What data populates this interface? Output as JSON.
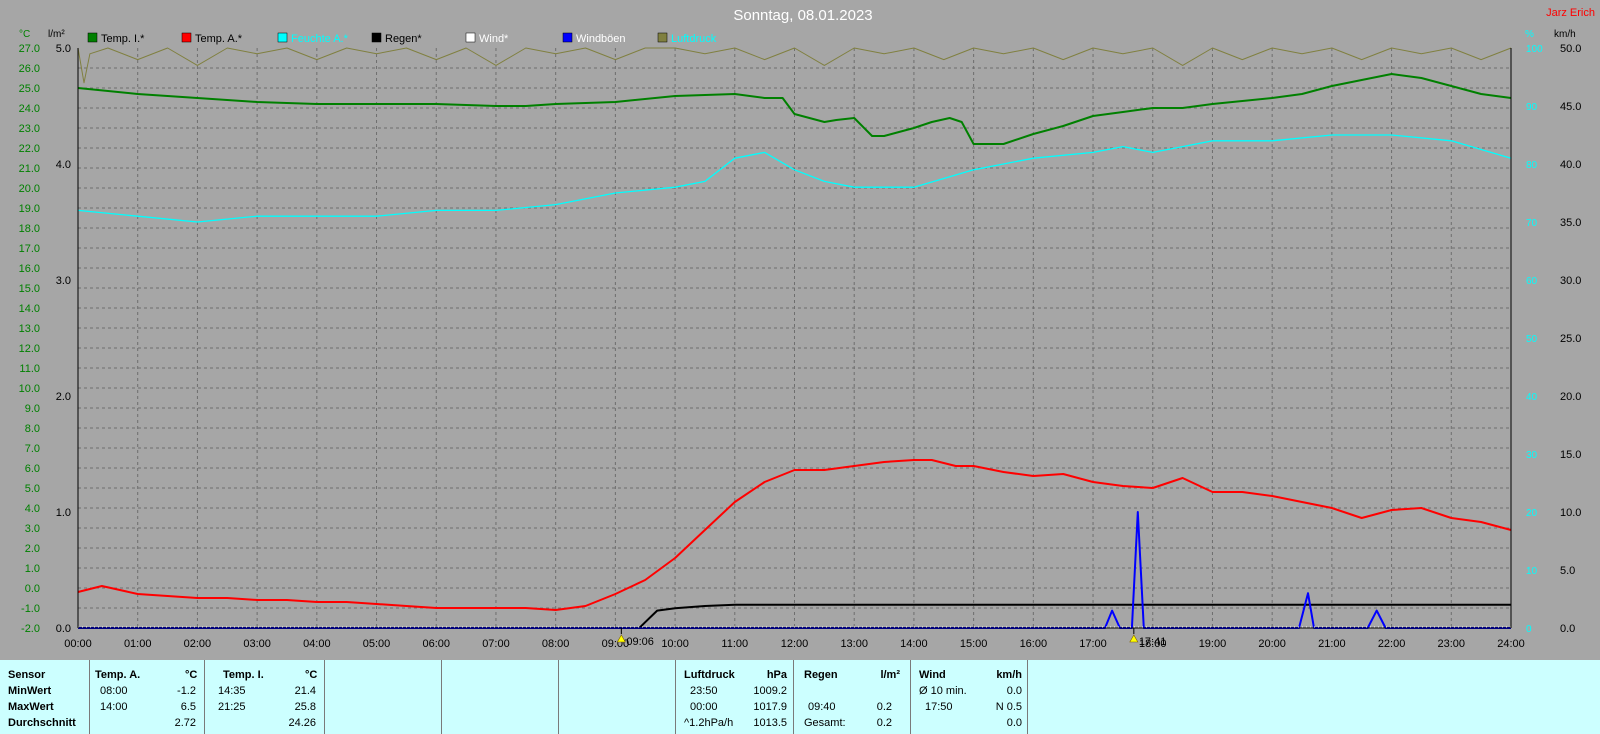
{
  "title": "Sonntag, 08.01.2023",
  "author": "Jarz Erich",
  "axis_units": {
    "temp": "°C",
    "rain": "l/m²",
    "humidity": "%",
    "wind": "km/h"
  },
  "colors": {
    "temp_in": "#008000",
    "temp_out": "#ff0000",
    "humidity": "#00ffff",
    "rain": "#000000",
    "wind": "#ffffff",
    "gusts": "#0000ff",
    "pressure": "#808040"
  },
  "legend": [
    {
      "label": "Temp. I.*",
      "color": "#008000",
      "text_color": "#000000"
    },
    {
      "label": "Temp. A.*",
      "color": "#ff0000",
      "text_color": "#000000"
    },
    {
      "label": "Feuchte A.*",
      "color": "#00ffff",
      "text_color": "#00ffff"
    },
    {
      "label": "Regen*",
      "color": "#000000",
      "text_color": "#000000"
    },
    {
      "label": "Wind*",
      "color": "#ffffff",
      "text_color": "#ffffff"
    },
    {
      "label": "Windböen",
      "color": "#0000ff",
      "text_color": "#ffffff"
    },
    {
      "label": "Luftdruck",
      "color": "#808040",
      "text_color": "#00ffff"
    }
  ],
  "markers": [
    {
      "icon": "sunrise-icon",
      "label": "09:06",
      "hour": 9.1
    },
    {
      "icon": "sunset-icon",
      "label": "17:41",
      "hour": 17.683
    }
  ],
  "chart_data": {
    "type": "line",
    "x_range": [
      0,
      24
    ],
    "x_tick_labels": [
      "00:00",
      "01:00",
      "02:00",
      "03:00",
      "04:00",
      "05:00",
      "06:00",
      "07:00",
      "08:00",
      "09:00",
      "10:00",
      "11:00",
      "12:00",
      "13:00",
      "14:00",
      "15:00",
      "16:00",
      "17:00",
      "18:00",
      "19:00",
      "20:00",
      "21:00",
      "22:00",
      "23:00",
      "24:00"
    ],
    "temp_axis": {
      "range": [
        -2,
        27
      ],
      "tick_labels": [
        "27.0",
        "26.0",
        "25.0",
        "24.0",
        "23.0",
        "22.0",
        "21.0",
        "20.0",
        "19.0",
        "18.0",
        "17.0",
        "16.0",
        "15.0",
        "14.0",
        "13.0",
        "12.0",
        "11.0",
        "10.0",
        "9.0",
        "8.0",
        "7.0",
        "6.0",
        "5.0",
        "4.0",
        "3.0",
        "2.0",
        "1.0",
        "0.0",
        "-1.0",
        "-2.0"
      ]
    },
    "rain_axis": {
      "range": [
        0,
        5
      ],
      "tick_labels": [
        "5.0",
        "4.0",
        "3.0",
        "2.0",
        "1.0",
        "0.0"
      ]
    },
    "humidity_axis": {
      "range": [
        0,
        100
      ],
      "tick_labels": [
        "100",
        "90",
        "80",
        "70",
        "60",
        "50",
        "40",
        "30",
        "20",
        "10",
        "0"
      ]
    },
    "wind_axis": {
      "range": [
        0,
        50
      ],
      "tick_labels": [
        "50.0",
        "45.0",
        "40.0",
        "35.0",
        "30.0",
        "25.0",
        "20.0",
        "15.0",
        "10.0",
        "5.0",
        "0.0"
      ]
    },
    "series": [
      {
        "name": "Temp. I.*",
        "axis": "temp",
        "color": "#008000",
        "x": [
          0,
          1,
          2,
          3,
          4,
          5,
          6,
          7,
          7.5,
          8,
          9,
          10,
          11,
          11.5,
          11.8,
          12,
          12.5,
          12.7,
          13,
          13.3,
          13.5,
          14,
          14.3,
          14.6,
          14.8,
          15,
          15.5,
          16,
          16.5,
          17,
          17.5,
          18,
          18.5,
          19,
          20,
          20.5,
          21,
          21.5,
          22,
          22.5,
          23,
          23.5,
          24
        ],
        "y": [
          25.0,
          24.7,
          24.5,
          24.3,
          24.2,
          24.2,
          24.2,
          24.1,
          24.1,
          24.2,
          24.3,
          24.6,
          24.7,
          24.5,
          24.5,
          23.7,
          23.3,
          23.4,
          23.5,
          22.6,
          22.6,
          23.0,
          23.3,
          23.5,
          23.3,
          22.2,
          22.2,
          22.7,
          23.1,
          23.6,
          23.8,
          24.0,
          24.0,
          24.2,
          24.5,
          24.7,
          25.1,
          25.4,
          25.7,
          25.5,
          25.1,
          24.7,
          24.5
        ]
      },
      {
        "name": "Temp. A.*",
        "axis": "temp",
        "color": "#ff0000",
        "x": [
          0,
          0.4,
          1,
          1.5,
          2,
          2.5,
          3,
          3.5,
          4,
          4.5,
          5,
          5.5,
          6,
          6.5,
          7,
          7.5,
          8,
          8.5,
          9,
          9.5,
          10,
          10.5,
          11,
          11.5,
          12,
          12.5,
          13,
          13.5,
          14,
          14.3,
          14.7,
          15,
          15.5,
          16,
          16.5,
          17,
          17.5,
          18,
          18.5,
          19,
          19.5,
          20,
          20.5,
          21,
          21.5,
          22,
          22.5,
          23,
          23.5,
          24
        ],
        "y": [
          -0.2,
          0.1,
          -0.3,
          -0.4,
          -0.5,
          -0.5,
          -0.6,
          -0.6,
          -0.7,
          -0.7,
          -0.8,
          -0.9,
          -1.0,
          -1.0,
          -1.0,
          -1.0,
          -1.1,
          -0.9,
          -0.3,
          0.4,
          1.5,
          2.9,
          4.3,
          5.3,
          5.9,
          5.9,
          6.1,
          6.3,
          6.4,
          6.4,
          6.1,
          6.1,
          5.8,
          5.6,
          5.7,
          5.3,
          5.1,
          5.0,
          5.5,
          4.8,
          4.8,
          4.6,
          4.3,
          4.0,
          3.5,
          3.9,
          4.0,
          3.5,
          3.3,
          2.9
        ]
      },
      {
        "name": "Feuchte A.*",
        "axis": "humidity",
        "color": "#00ffff",
        "x": [
          0,
          1,
          2,
          3,
          4,
          5,
          6,
          7,
          8,
          9,
          10,
          10.5,
          11,
          11.5,
          12,
          12.5,
          13,
          13.5,
          14,
          15,
          16,
          17,
          17.5,
          18,
          18.5,
          19,
          20,
          21,
          22,
          23,
          24
        ],
        "y": [
          72,
          71,
          70,
          71,
          71,
          71,
          72,
          72,
          73,
          75,
          76,
          77,
          81,
          82,
          79,
          77,
          76,
          76,
          76,
          79,
          81,
          82,
          83,
          82,
          83,
          84,
          84,
          85,
          85,
          84,
          81
        ]
      },
      {
        "name": "Regen*",
        "axis": "rain",
        "color": "#000000",
        "x": [
          0,
          9.4,
          9.5,
          9.6,
          9.7,
          10,
          10.5,
          11,
          12,
          24
        ],
        "y": [
          0,
          0,
          0.05,
          0.1,
          0.15,
          0.17,
          0.19,
          0.2,
          0.2,
          0.2
        ]
      },
      {
        "name": "Windböen",
        "axis": "wind",
        "color": "#0000ff",
        "x": [
          0,
          17.2,
          17.32,
          17.45,
          17.65,
          17.75,
          17.85,
          17.95,
          20.3,
          20.45,
          20.6,
          20.7,
          20.8,
          21.6,
          21.75,
          21.9,
          24
        ],
        "y": [
          0,
          0,
          1.5,
          0,
          0,
          10,
          0,
          0,
          0,
          0,
          3,
          0,
          0,
          0,
          1.5,
          0,
          0
        ]
      },
      {
        "name": "Luftdruck",
        "axis": "humidity",
        "color": "#808040",
        "x": [
          0,
          0.1,
          0.2,
          0.5,
          1,
          1.5,
          2,
          2.5,
          3,
          3.5,
          4,
          4.5,
          5,
          5.5,
          6,
          6.5,
          7,
          7.5,
          8,
          8.5,
          9,
          9.5,
          10,
          10.5,
          11,
          11.5,
          12,
          12.5,
          13,
          13.5,
          14,
          14.5,
          15,
          15.5,
          16,
          16.5,
          17,
          17.5,
          18,
          18.5,
          19,
          19.5,
          20,
          20.5,
          21,
          21.5,
          22,
          22.5,
          23,
          23.5,
          24
        ],
        "y": [
          100,
          94,
          99,
          100,
          98,
          100,
          97,
          100,
          99,
          100,
          98,
          100,
          99,
          100,
          98,
          100,
          97,
          100,
          99,
          100,
          98,
          100,
          100,
          99,
          100,
          98,
          100,
          97,
          100,
          99,
          100,
          98,
          100,
          99,
          100,
          98,
          100,
          99,
          100,
          97,
          100,
          98,
          100,
          99,
          100,
          98,
          100,
          99,
          100,
          98,
          100
        ]
      }
    ]
  },
  "table": {
    "sensor": {
      "header": "Sensor",
      "rows": [
        "MinWert",
        "MaxWert",
        "Durchschnitt"
      ]
    },
    "temp_a": {
      "header": "Temp. A.",
      "unit": "°C",
      "min_time": "08:00",
      "min_val": "-1.2",
      "max_time": "14:00",
      "max_val": "6.5",
      "avg": "2.72"
    },
    "temp_i": {
      "header": "Temp. I.",
      "unit": "°C",
      "min_time": "14:35",
      "min_val": "21.4",
      "max_time": "21:25",
      "max_val": "25.8",
      "avg": "24.26"
    },
    "pressure": {
      "header": "Luftdruck",
      "unit": "hPa",
      "r1_label": "23:50",
      "r1_val": "1009.2",
      "r2_label": "00:00",
      "r2_val": "1017.9",
      "r3_label": "^1.2hPa/h",
      "r3_val": "1013.5"
    },
    "rain": {
      "header": "Regen",
      "unit": "l/m²",
      "r2_label": "09:40",
      "r2_val": "0.2",
      "r3_label": "Gesamt:",
      "r3_val": "0.2"
    },
    "wind": {
      "header": "Wind",
      "unit": "km/h",
      "r1_label": "Ø 10 min.",
      "r1_val": "0.0",
      "r2_label": "17:50",
      "r2_val": "N 0.5",
      "r3_val": "0.0"
    }
  }
}
